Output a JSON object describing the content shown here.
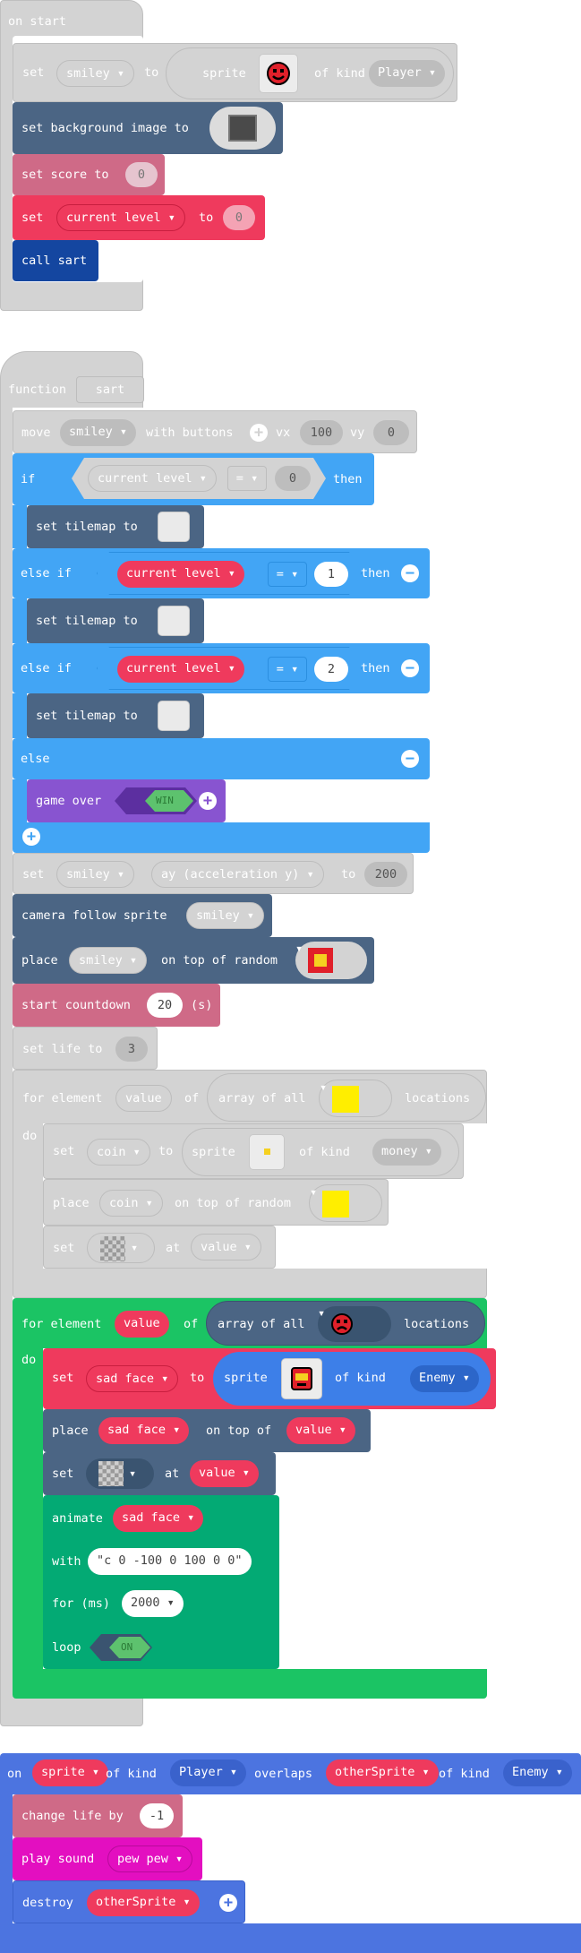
{
  "on_start": {
    "hat": "on start",
    "set_sprite": {
      "set": "set",
      "var": "smiley",
      "to": "to",
      "sprite": "sprite",
      "of_kind": "of kind",
      "kind": "Player"
    },
    "set_bg": {
      "label": "set background image to"
    },
    "set_score": {
      "label": "set score to",
      "value": "0"
    },
    "set_level": {
      "set": "set",
      "var": "current level",
      "to": "to",
      "value": "0"
    },
    "call": "call sart"
  },
  "function_sart": {
    "hat": "function",
    "name": "sart",
    "move": {
      "move": "move",
      "var": "smiley",
      "with_buttons": "with buttons",
      "vx": "vx",
      "vx_value": "100",
      "vy": "vy",
      "vy_value": "0"
    },
    "if": {
      "kw": "if",
      "var": "current level",
      "op": "=",
      "value": "0",
      "then": "then"
    },
    "tilemap_1": "set tilemap to",
    "else_if_1": {
      "kw": "else if",
      "var": "current level",
      "op": "=",
      "value": "1",
      "then": "then"
    },
    "tilemap_2": "set tilemap to",
    "else_if_2": {
      "kw": "else if",
      "var": "current level",
      "op": "=",
      "value": "2",
      "then": "then"
    },
    "tilemap_3": "set tilemap to",
    "else": "else",
    "game_over": {
      "label": "game over",
      "flag": "WIN"
    },
    "set_ay": {
      "set": "set",
      "var": "smiley",
      "prop": "ay (acceleration y)",
      "to": "to",
      "value": "200"
    },
    "camera": {
      "label": "camera follow sprite",
      "var": "smiley"
    },
    "place": {
      "place": "place",
      "var": "smiley",
      "on_top": "on top of random"
    },
    "countdown": {
      "label": "start countdown",
      "value": "20",
      "unit": "(s)"
    },
    "set_life": {
      "label": "set life to",
      "value": "3"
    },
    "for1": {
      "for_el": "for element",
      "var": "value",
      "of": "of",
      "array": "array of all",
      "locations": "locations",
      "do": "do",
      "set_coin": {
        "set": "set",
        "var": "coin",
        "to": "to",
        "sprite": "sprite",
        "of_kind": "of kind",
        "kind": "money"
      },
      "place_coin": {
        "place": "place",
        "var": "coin",
        "on_top": "on top of random"
      },
      "set_tile": {
        "set": "set",
        "at": "at",
        "var": "value"
      }
    },
    "for2": {
      "for_el": "for element",
      "var": "value",
      "of": "of",
      "array": "array of all",
      "locations": "locations",
      "do": "do",
      "set_face": {
        "set": "set",
        "var": "sad face",
        "to": "to",
        "sprite": "sprite",
        "of_kind": "of kind",
        "kind": "Enemy"
      },
      "place_face": {
        "place": "place",
        "var": "sad face",
        "on_top": "on top of",
        "target": "value"
      },
      "set_tile": {
        "set": "set",
        "at": "at",
        "var": "value"
      },
      "animate": {
        "label": "animate",
        "var": "sad face",
        "with": "with",
        "path": "\"c 0 -100 0 100 0 0\"",
        "for_ms": "for (ms)",
        "ms": "2000",
        "loop": "loop",
        "loop_flag": "ON"
      }
    }
  },
  "overlap": {
    "on": "on",
    "sprite": "sprite",
    "of_kind": "of kind",
    "kind": "Player",
    "overlaps": "overlaps",
    "other": "otherSprite",
    "of_kind2": "of kind",
    "kind2": "Enemy",
    "change_life": {
      "label": "change life by",
      "value": "-1"
    },
    "play_sound": {
      "label": "play sound",
      "sound": "pew pew"
    },
    "destroy": {
      "label": "destroy",
      "var": "otherSprite"
    }
  },
  "colors": {
    "disabled": "#d3d3d3",
    "sprites": "#4b6584",
    "info": "#cf6a87",
    "variables": "#ef3a5d",
    "functions": "#1446a0",
    "logic": "#42a5f5",
    "loops": "#1bc464",
    "game": "#8854d0",
    "animation": "#03aa74",
    "music": "#e30fc0",
    "events": "#4b6584"
  }
}
